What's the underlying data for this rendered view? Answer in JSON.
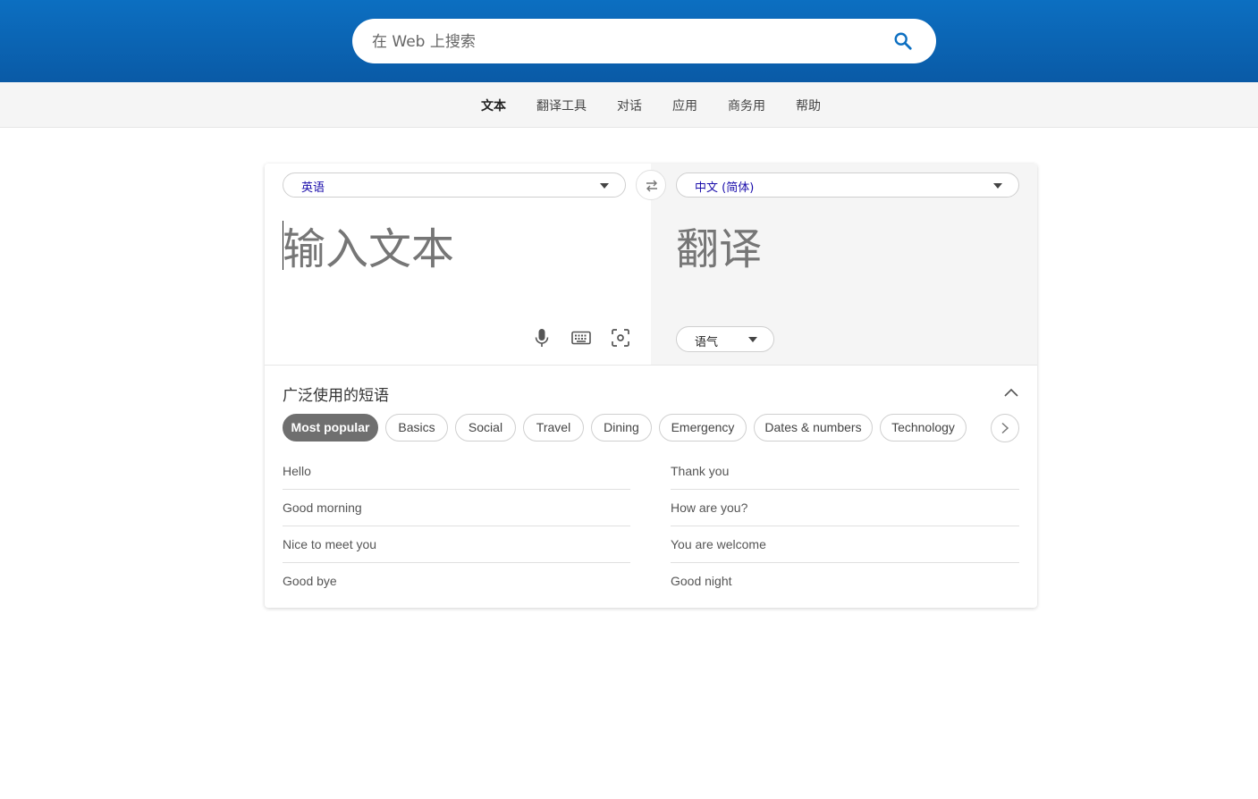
{
  "search": {
    "placeholder": "在 Web 上搜索",
    "icon": "search-icon"
  },
  "nav": {
    "items": [
      {
        "label": "文本",
        "active": true
      },
      {
        "label": "翻译工具",
        "active": false
      },
      {
        "label": "对话",
        "active": false
      },
      {
        "label": "应用",
        "active": false
      },
      {
        "label": "商务用",
        "active": false
      },
      {
        "label": "帮助",
        "active": false
      }
    ]
  },
  "translator": {
    "source_language": "英语",
    "target_language": "中文 (简体)",
    "source_placeholder": "输入文本",
    "target_placeholder": "翻译",
    "tone_label": "语气",
    "icons": [
      "swap-icon",
      "microphone-icon",
      "keyboard-icon",
      "camera-scan-icon",
      "chevron-down-icon"
    ]
  },
  "phrases": {
    "title": "广泛使用的短语",
    "categories": [
      "Most popular",
      "Basics",
      "Social",
      "Travel",
      "Dining",
      "Emergency",
      "Dates & numbers",
      "Technology"
    ],
    "active_category": "Most popular",
    "left": [
      "Hello",
      "Good morning",
      "Nice to meet you",
      "Good bye"
    ],
    "right": [
      "Thank you",
      "How are you?",
      "You are welcome",
      "Good night"
    ]
  },
  "colors": {
    "header_blue": "#0c6fc1",
    "link_blue": "#1a0dab",
    "chip_active": "#6f6f6f"
  }
}
